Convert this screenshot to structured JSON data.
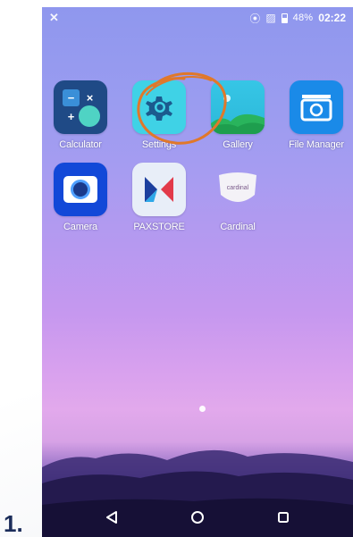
{
  "step_label": "1.",
  "status_bar": {
    "left_icon": "notification-icon",
    "icons": [
      "vibrate-icon",
      "no-sim-icon",
      "battery-icon"
    ],
    "battery": "48%",
    "time": "02:22"
  },
  "apps": [
    {
      "id": "calculator",
      "label": "Calculator",
      "icon": "calculator-icon"
    },
    {
      "id": "settings",
      "label": "Settings",
      "icon": "gear-icon",
      "highlighted": true
    },
    {
      "id": "gallery",
      "label": "Gallery",
      "icon": "gallery-icon"
    },
    {
      "id": "file-manager",
      "label": "File Manager",
      "icon": "file-manager-icon"
    },
    {
      "id": "camera",
      "label": "Camera",
      "icon": "camera-icon"
    },
    {
      "id": "paxstore",
      "label": "PAXSTORE",
      "icon": "paxstore-icon"
    },
    {
      "id": "cardinal",
      "label": "Cardinal",
      "icon": "cardinal-icon",
      "icon_text": "cardinal"
    }
  ],
  "annotation": {
    "color": "#e0782a",
    "target": "settings"
  },
  "nav": {
    "back": "back-triangle-icon",
    "home": "home-circle-icon",
    "recents": "recents-square-icon"
  },
  "colors": {
    "label_color": "#1b2c5a",
    "annotation": "#e0782a"
  }
}
